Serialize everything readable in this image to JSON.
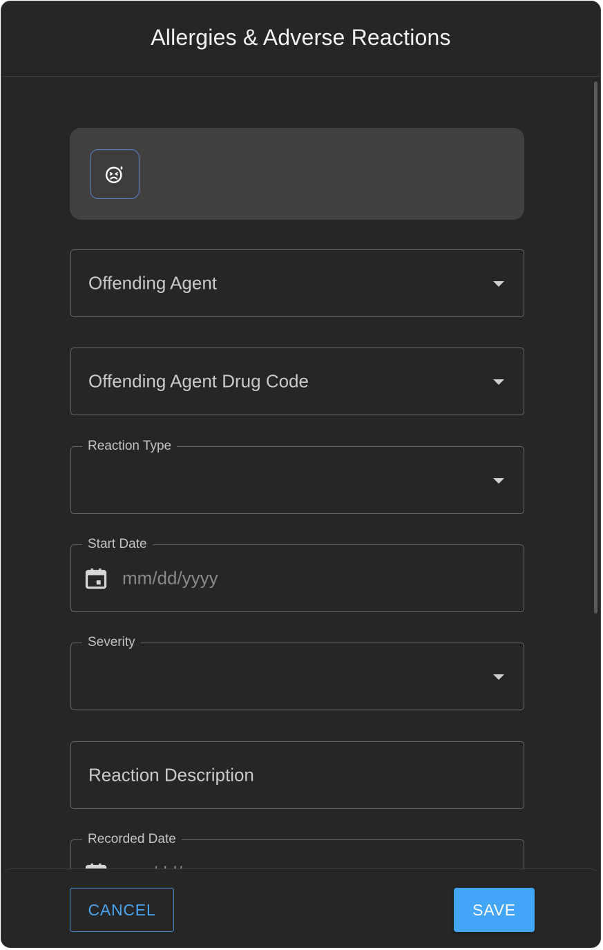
{
  "dialog": {
    "title": "Allergies & Adverse Reactions"
  },
  "banner": {
    "icon": "sick-face-icon"
  },
  "fields": {
    "offending_agent": {
      "placeholder": "Offending Agent",
      "icon": "caret-down-icon"
    },
    "offending_agent_drug_code": {
      "placeholder": "Offending Agent Drug Code",
      "icon": "caret-down-icon"
    },
    "reaction_type": {
      "label": "Reaction Type",
      "value": "",
      "icon": "caret-down-icon"
    },
    "start_date": {
      "label": "Start Date",
      "placeholder": "mm/dd/yyyy",
      "icon": "calendar-icon"
    },
    "severity": {
      "label": "Severity",
      "value": "",
      "icon": "caret-down-icon"
    },
    "reaction_description": {
      "placeholder": "Reaction Description"
    },
    "recorded_date": {
      "label": "Recorded Date",
      "placeholder": "mm/dd/yyyy",
      "icon": "calendar-icon"
    }
  },
  "footer": {
    "cancel_label": "CANCEL",
    "save_label": "SAVE"
  },
  "colors": {
    "background": "#262626",
    "banner": "#414141",
    "field_border": "#6b6b6b",
    "accent": "#42a5f5",
    "cancel_text": "#4aa3ee"
  }
}
